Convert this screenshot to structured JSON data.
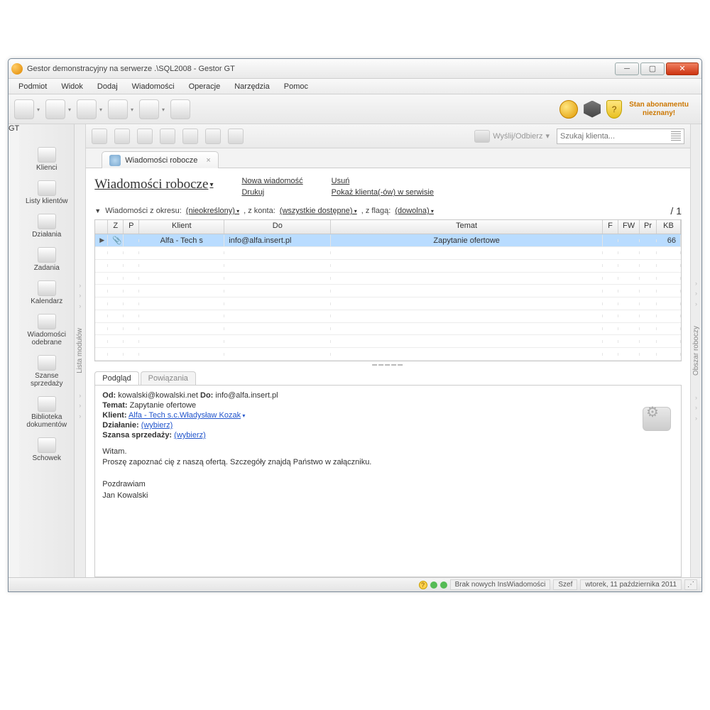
{
  "window": {
    "title": "Gestor demonstracyjny na serwerze .\\SQL2008 - Gestor GT"
  },
  "menubar": [
    "Podmiot",
    "Widok",
    "Dodaj",
    "Wiadomości",
    "Operacje",
    "Narzędzia",
    "Pomoc"
  ],
  "subscription": {
    "line1": "Stan abonamentu",
    "line2": "nieznany!"
  },
  "leftnav": [
    {
      "label": "Klienci"
    },
    {
      "label": "Listy klientów"
    },
    {
      "label": "Działania"
    },
    {
      "label": "Zadania"
    },
    {
      "label": "Kalendarz"
    },
    {
      "label": "Wiadomości odebrane"
    },
    {
      "label": "Szanse sprzedaży"
    },
    {
      "label": "Biblioteka dokumentów"
    },
    {
      "label": "Schowek"
    }
  ],
  "vstrip_left": "Lista modułów",
  "vstrip_right": "Obszar roboczy",
  "toolbar2": {
    "sendrecv": "Wyślij/Odbierz",
    "search_placeholder": "Szukaj klienta..."
  },
  "tab": {
    "label": "Wiadomości robocze"
  },
  "heading": "Wiadomości robocze",
  "actions": {
    "new": "Nowa wiadomość",
    "print": "Drukuj",
    "delete": "Usuń",
    "show": "Pokaż klienta(-ów) w serwisie"
  },
  "filters": {
    "label": "Wiadomości z okresu:",
    "period": "(nieokreślony)",
    "from_label": ", z konta:",
    "account": "(wszystkie dostępne)",
    "flag_label": ", z flagą:",
    "flag": "(dowolna)",
    "page": "/ 1"
  },
  "grid": {
    "cols": {
      "z": "Z",
      "p": "P",
      "klient": "Klient",
      "do": "Do",
      "temat": "Temat",
      "f": "F",
      "fw": "FW",
      "pr": "Pr",
      "kb": "KB"
    },
    "row": {
      "klient": "Alfa - Tech s",
      "do": "info@alfa.insert.pl",
      "temat": "Zapytanie ofertowe",
      "kb": "66"
    }
  },
  "preview": {
    "tabs": {
      "podglad": "Podgląd",
      "powiazania": "Powiązania"
    },
    "from_l": "Od:",
    "from": "kowalski@kowalski.net",
    "to_l": "Do:",
    "to": "info@alfa.insert.pl",
    "subj_l": "Temat:",
    "subj": "Zapytanie ofertowe",
    "klient_l": "Klient:",
    "klient": "Alfa - Tech s.c.Władysław Kozak",
    "dzialanie_l": "Działanie:",
    "dzialanie": "(wybierz)",
    "szansa_l": "Szansa sprzedaży:",
    "szansa": "(wybierz)",
    "body1": "Witam.",
    "body2": "Proszę zapoznać cię z naszą ofertą. Szczegóły znajdą Państwo w załączniku.",
    "body3": "Pozdrawiam",
    "body4": "Jan Kowalski"
  },
  "statusbar": {
    "news": "Brak nowych InsWiadomości",
    "user": "Szef",
    "date": "wtorek, 11 października 2011"
  }
}
